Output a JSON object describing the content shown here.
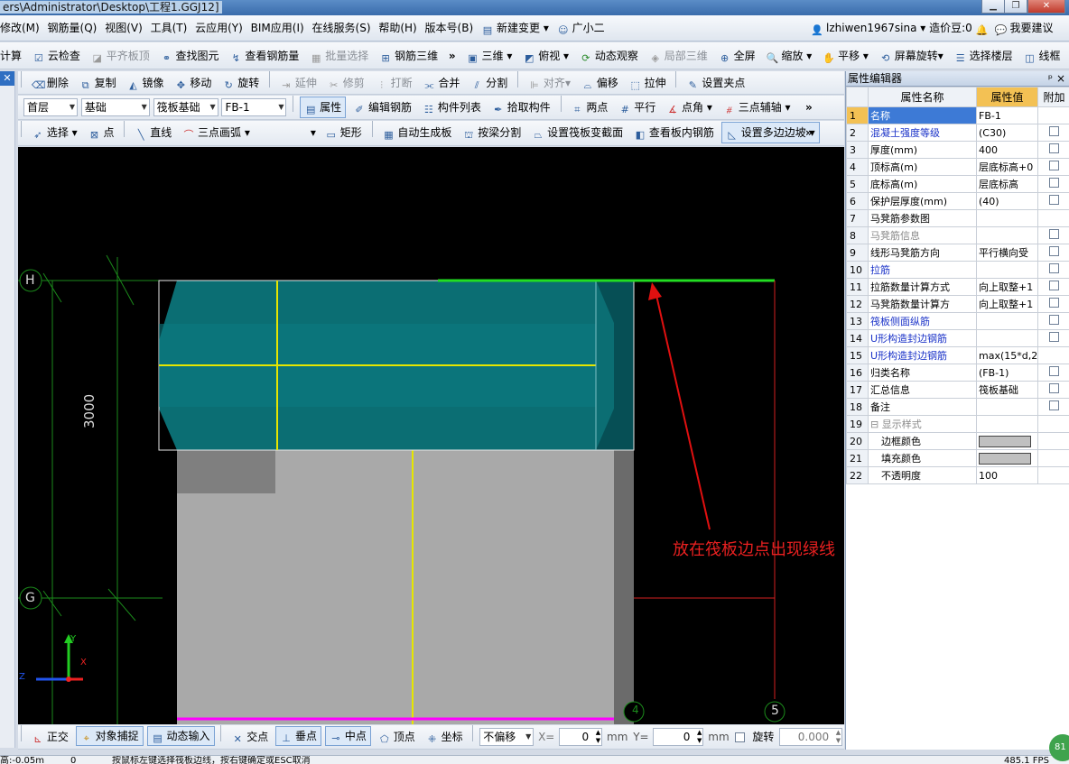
{
  "title_bar": {
    "path": "ers\\Administrator\\Desktop\\工程1.GGJ12]",
    "buttons": {
      "minimize": "▁",
      "restore": "❐",
      "close": "✕"
    }
  },
  "menu": {
    "items": [
      "修改(M)",
      "钢筋量(Q)",
      "视图(V)",
      "工具(T)",
      "云应用(Y)",
      "BIM应用(I)",
      "在线服务(S)",
      "帮助(H)",
      "版本号(B)",
      "新建变更",
      "广小二"
    ],
    "user": "lzhiwen1967sina",
    "cost_beans": "造价豆:0",
    "suggest": "我要建议"
  },
  "toolbar1": {
    "items": [
      "计算",
      "云检查",
      "平齐板顶",
      "查找图元",
      "查看钢筋量",
      "批量选择",
      "钢筋三维",
      "三维",
      "俯视",
      "动态观察",
      "局部三维",
      "全屏",
      "缩放",
      "平移",
      "屏幕旋转",
      "选择楼层",
      "线框"
    ]
  },
  "toolbar2": {
    "items": [
      "删除",
      "复制",
      "镜像",
      "移动",
      "旋转",
      "延伸",
      "修剪",
      "打断",
      "合并",
      "分割",
      "对齐",
      "偏移",
      "拉伸",
      "设置夹点"
    ]
  },
  "toolbar3": {
    "floor": "首层",
    "category": "基础",
    "type": "筏板基础",
    "element": "FB-1",
    "items": [
      "属性",
      "编辑钢筋",
      "构件列表",
      "拾取构件",
      "两点",
      "平行",
      "点角",
      "三点辅轴"
    ]
  },
  "toolbar4": {
    "items": [
      "选择",
      "点",
      "直线",
      "三点画弧",
      "矩形",
      "自动生成板",
      "按梁分割",
      "设置筏板变截面",
      "查看板内钢筋",
      "设置多边边坡"
    ]
  },
  "canvas": {
    "axis_labels": {
      "H": "H",
      "G": "G",
      "five": "5",
      "four": "4"
    },
    "dimension": "3000",
    "annotation": "放在筏板边点出现绿线",
    "coord_axes": {
      "x": "X",
      "y": "Y",
      "z": "Z"
    }
  },
  "properties": {
    "title": "属性编辑器",
    "pin": "ᵖ",
    "close": "×",
    "headers": [
      "属性名称",
      "属性值",
      "附加"
    ],
    "rows": [
      {
        "n": "1",
        "name": "名称",
        "value": "FB-1",
        "style": "",
        "cb": false
      },
      {
        "n": "2",
        "name": "混凝土强度等级",
        "value": "(C30)",
        "style": "blue",
        "cb": true
      },
      {
        "n": "3",
        "name": "厚度(mm)",
        "value": "400",
        "style": "",
        "cb": true
      },
      {
        "n": "4",
        "name": "顶标高(m)",
        "value": "层底标高+0",
        "style": "",
        "cb": true
      },
      {
        "n": "5",
        "name": "底标高(m)",
        "value": "层底标高",
        "style": "",
        "cb": true
      },
      {
        "n": "6",
        "name": "保护层厚度(mm)",
        "value": "(40)",
        "style": "",
        "cb": true
      },
      {
        "n": "7",
        "name": "马凳筋参数图",
        "value": "",
        "style": "",
        "cb": false
      },
      {
        "n": "8",
        "name": "马凳筋信息",
        "value": "",
        "style": "gray",
        "cb": true
      },
      {
        "n": "9",
        "name": "线形马凳筋方向",
        "value": "平行横向受",
        "style": "",
        "cb": true
      },
      {
        "n": "10",
        "name": "拉筋",
        "value": "",
        "style": "blue",
        "cb": true
      },
      {
        "n": "11",
        "name": "拉筋数量计算方式",
        "value": "向上取整+1",
        "style": "",
        "cb": true
      },
      {
        "n": "12",
        "name": "马凳筋数量计算方",
        "value": "向上取整+1",
        "style": "",
        "cb": true
      },
      {
        "n": "13",
        "name": "筏板侧面纵筋",
        "value": "",
        "style": "blue",
        "cb": true
      },
      {
        "n": "14",
        "name": "U形构造封边钢筋",
        "value": "",
        "style": "blue",
        "cb": true
      },
      {
        "n": "15",
        "name": "U形构造封边钢筋",
        "value": "max(15*d,2",
        "style": "blue",
        "cb": false
      },
      {
        "n": "16",
        "name": "归类名称",
        "value": "(FB-1)",
        "style": "",
        "cb": true
      },
      {
        "n": "17",
        "name": "汇总信息",
        "value": "筏板基础",
        "style": "",
        "cb": true
      },
      {
        "n": "18",
        "name": "备注",
        "value": "",
        "style": "",
        "cb": true
      },
      {
        "n": "19",
        "name": "显示样式",
        "value": "",
        "style": "gray",
        "cb": false
      },
      {
        "n": "20",
        "name": "边框颜色",
        "value": "",
        "style": "",
        "cb": false
      },
      {
        "n": "21",
        "name": "填充颜色",
        "value": "",
        "style": "",
        "cb": false
      },
      {
        "n": "22",
        "name": "不透明度",
        "value": "100",
        "style": "",
        "cb": false
      }
    ]
  },
  "snapbar": {
    "items": [
      "正交",
      "对象捕捉",
      "动态输入",
      "交点",
      "垂点",
      "中点",
      "顶点",
      "坐标"
    ],
    "offset_mode": "不偏移",
    "x_label": "X=",
    "x_value": "0",
    "y_label": "Y=",
    "y_value": "0",
    "unit": "mm",
    "rotate_label": "旋转",
    "rotate_value": "0.000",
    "degree": "°"
  },
  "status": {
    "elevation": "高:-0.05m",
    "zero": "0",
    "hint": "按鼠标左键选择筏板边线，按右键确定或ESC取消",
    "coords": "485.1 FPS",
    "badge": "81"
  }
}
